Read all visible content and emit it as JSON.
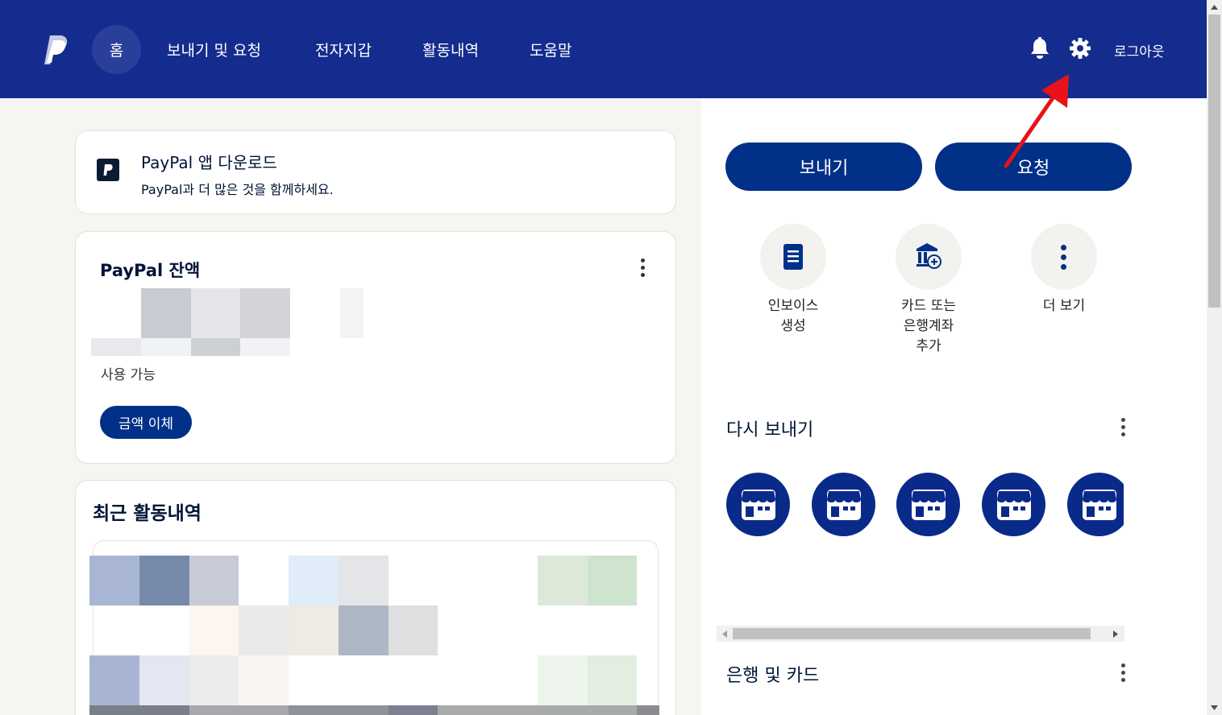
{
  "header": {
    "nav": [
      "홈",
      "보내기 및 요청",
      "전자지갑",
      "활동내역",
      "도움말"
    ],
    "logout": "로그아웃"
  },
  "app_card": {
    "title": "PayPal 앱 다운로드",
    "subtitle": "PayPal과 더 많은 것을 함께하세요."
  },
  "balance_card": {
    "title": "PayPal 잔액",
    "available_label": "사용 가능",
    "transfer_button": "금액 이체"
  },
  "activity": {
    "title": "최근 활동내역"
  },
  "actions": {
    "send": "보내기",
    "request": "요청",
    "quick": [
      {
        "line1": "인보이스",
        "line2": "생성",
        "line3": ""
      },
      {
        "line1": "카드 또는",
        "line2": "은행계좌",
        "line3": "추가"
      },
      {
        "line1": "더 보기",
        "line2": "",
        "line3": ""
      }
    ]
  },
  "send_again": {
    "title": "다시 보내기"
  },
  "banks": {
    "title": "은행 및 카드"
  },
  "colors": {
    "header": "#142c8e",
    "primary_button": "#003087",
    "store_circle": "#0a2a8a",
    "annotation_arrow": "#e8121a"
  },
  "icons": [
    "paypal-logo",
    "bell-icon",
    "gear-icon",
    "invoice-icon",
    "bank-add-icon",
    "more-vertical-icon",
    "store-icon"
  ]
}
